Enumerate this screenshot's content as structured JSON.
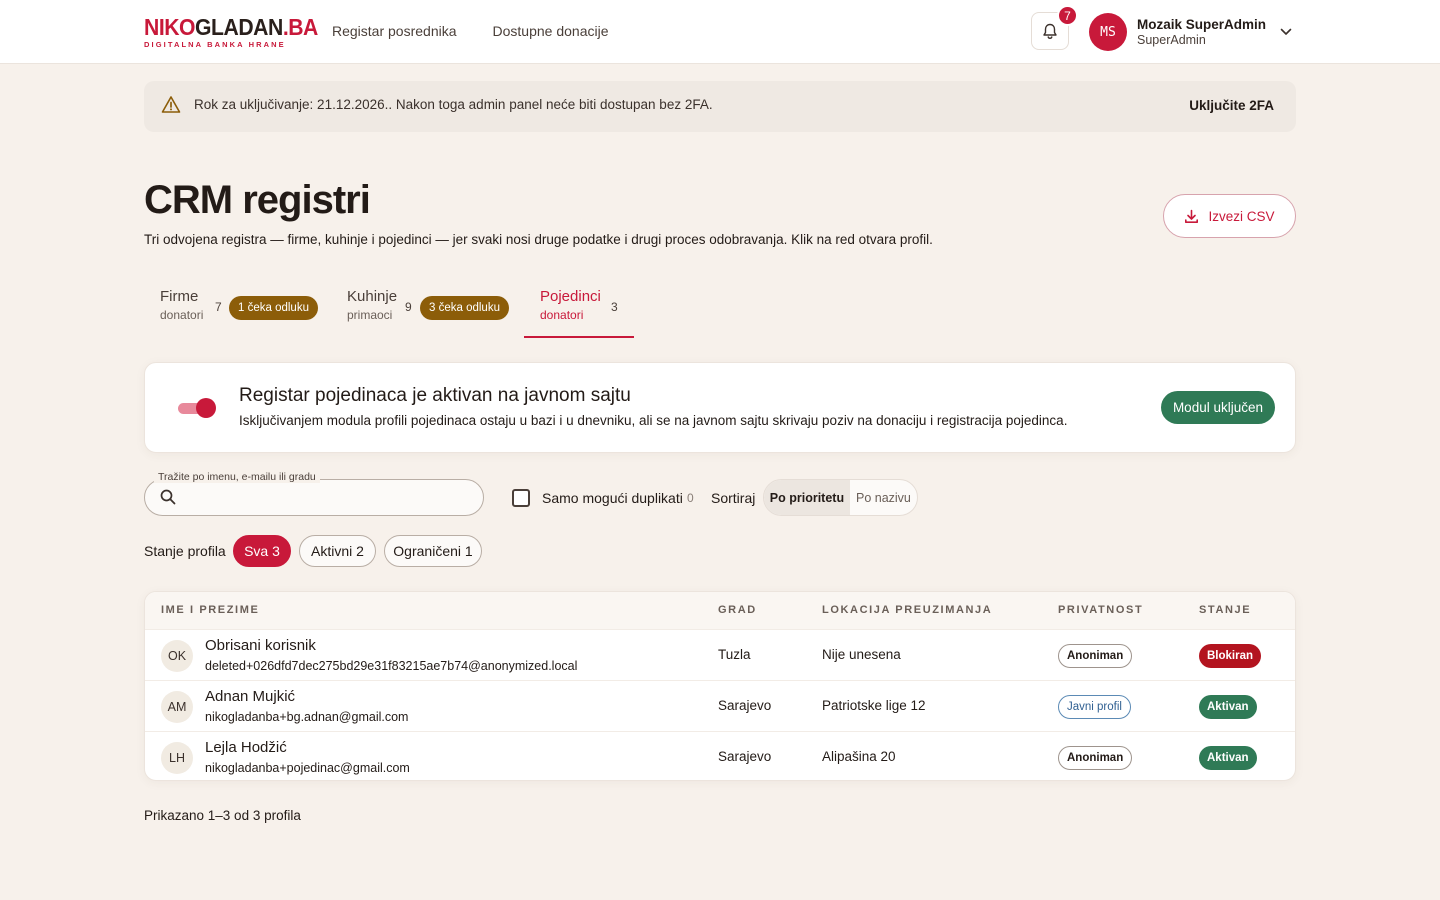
{
  "header": {
    "logo_red_prefix": "NIKO",
    "logo_dark_middle": "GLADAN",
    "logo_red_suffix": ".BA",
    "logo_tagline": "DIGITALNA BANKA HRANE",
    "nav": [
      {
        "label": "Registar posrednika"
      },
      {
        "label": "Dostupne donacije"
      }
    ],
    "notifications_count": "7",
    "user": {
      "initials": "MS",
      "name": "Mozaik SuperAdmin",
      "role": "SuperAdmin"
    }
  },
  "banner": {
    "text": "Rok za uključivanje: 21.12.2026.. Nakon toga admin panel neće biti dostupan bez 2FA.",
    "action": "Uključite 2FA"
  },
  "page": {
    "title": "CRM registri",
    "description": "Tri odvojena registra — firme, kuhinje i pojedinci — jer svaki nosi druge podatke i drugi proces odobravanja. Klik na red otvara profil.",
    "export_label": "Izvezi CSV"
  },
  "tabs": [
    {
      "label": "Firme",
      "sub": "donatori",
      "count": "7",
      "badge": "1 čeka odluku"
    },
    {
      "label": "Kuhinje",
      "sub": "primaoci",
      "count": "9",
      "badge": "3 čeka odluku"
    },
    {
      "label": "Pojedinci",
      "sub": "donatori",
      "count": "3",
      "badge": ""
    }
  ],
  "module": {
    "title": "Registar pojedinaca je aktivan na javnom sajtu",
    "description": "Isključivanjem modula profili pojedinaca ostaju u bazi i u dnevniku, ali se na javnom sajtu skrivaju poziv na donaciju i registracija pojedinca.",
    "status_label": "Modul uključen",
    "enabled": true
  },
  "filters": {
    "search_label": "Tražite po imenu, e-mailu ili gradu",
    "search_value": "",
    "duplicates_label": "Samo mogući duplikati",
    "duplicates_count": "0",
    "sort_label": "Sortiraj",
    "sort_options": [
      "Po prioritetu",
      "Po nazivu"
    ],
    "sort_selected": "Po prioritetu",
    "state_label": "Stanje profila",
    "state_chips": [
      "Sva 3",
      "Aktivni 2",
      "Ograničeni 1"
    ]
  },
  "table": {
    "columns": [
      "IME I PREZIME",
      "GRAD",
      "LOKACIJA PREUZIMANJA",
      "PRIVATNOST",
      "STANJE"
    ],
    "rows": [
      {
        "initials": "OK",
        "name": "Obrisani korisnik",
        "email": "deleted+026dfd7dec275bd29e31f83215ae7b74@anonymized.local",
        "city": "Tuzla",
        "location": "Nije unesena",
        "privacy": "Anoniman",
        "state": "Blokiran"
      },
      {
        "initials": "AM",
        "name": "Adnan Mujkić",
        "email": "nikogladanba+bg.adnan@gmail.com",
        "city": "Sarajevo",
        "location": "Patriotske lige 12",
        "privacy": "Javni profil",
        "state": "Aktivan"
      },
      {
        "initials": "LH",
        "name": "Lejla Hodžić",
        "email": "nikogladanba+pojedinac@gmail.com",
        "city": "Sarajevo",
        "location": "Alipašina 20",
        "privacy": "Anoniman",
        "state": "Aktivan"
      }
    ]
  },
  "footer": {
    "summary": "Prikazano 1–3 od 3 profila"
  },
  "colors": {
    "brand": "#c8193a",
    "success": "#2f7a56",
    "warning_badge": "#8c5d09",
    "danger": "#b3141f",
    "background": "#f7f1eb"
  }
}
